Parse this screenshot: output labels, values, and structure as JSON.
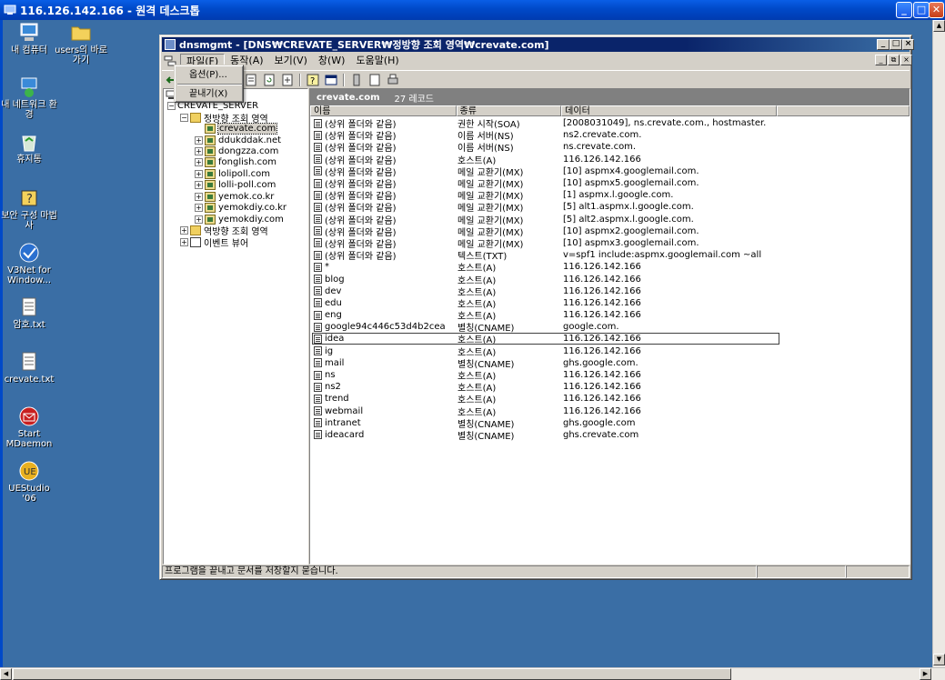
{
  "remote_desktop": {
    "title": "116.126.142.166 - 원격 데스크톱",
    "minimize": "_",
    "maximize": "□",
    "close": "✕"
  },
  "desktop_icons": [
    {
      "name": "my-computer",
      "label": "내 컴퓨터",
      "icon": "computer-icon"
    },
    {
      "name": "users-shortcut",
      "label": "users의 바로 가기",
      "icon": "folder-shortcut-icon"
    },
    {
      "name": "network-places",
      "label": "내 네트워크 환경",
      "icon": "network-icon"
    },
    {
      "name": "recycle-bin",
      "label": "휴지통",
      "icon": "recycle-bin-icon"
    },
    {
      "name": "security-wizard",
      "label": "보안 구성 마법사",
      "icon": "security-wizard-icon"
    },
    {
      "name": "v3net",
      "label": "V3Net for Window...",
      "icon": "v3net-icon"
    },
    {
      "name": "password-txt",
      "label": "암호.txt",
      "icon": "text-file-icon"
    },
    {
      "name": "crevate-txt",
      "label": "crevate.txt",
      "icon": "text-file-icon"
    },
    {
      "name": "start-mdaemon",
      "label": "Start MDaemon",
      "icon": "mdaemon-icon"
    },
    {
      "name": "uestudio",
      "label": "UEStudio '06",
      "icon": "uestudio-icon"
    }
  ],
  "mmc": {
    "title": "dnsmgmt - [DNS₩CREVATE_SERVER₩정방향 조회 영역₩crevate.com]",
    "menu": [
      {
        "label": "파일(F)",
        "active": true
      },
      {
        "label": "동작(A)",
        "active": false
      },
      {
        "label": "보기(V)",
        "active": false
      },
      {
        "label": "창(W)",
        "active": false
      },
      {
        "label": "도움말(H)",
        "active": false
      }
    ],
    "file_menu": {
      "items": [
        "옵션(P)...",
        "끝내기(X)"
      ]
    },
    "tree": {
      "server": "CREVATE_SERVER",
      "forward_zones": "정방향 조회 영역",
      "zones": [
        "crevate.com",
        "ddukddak.net",
        "dongzza.com",
        "fonglish.com",
        "lolipoll.com",
        "lolli-poll.com",
        "yemok.co.kr",
        "yemokdiy.co.kr",
        "yemokdiy.com"
      ],
      "selected_zone": "crevate.com",
      "reverse_zones": "역방향 조회 영역",
      "event_viewer": "이벤트 뷰어"
    },
    "list": {
      "zone_name": "crevate.com",
      "record_count": "27 레코드",
      "columns": [
        "이름",
        "종류",
        "데이터"
      ],
      "rows": [
        {
          "name": "(상위 폴더와 같음)",
          "type": "권한 시작(SOA)",
          "data": "[2008031049], ns.crevate.com., hostmaster."
        },
        {
          "name": "(상위 폴더와 같음)",
          "type": "이름 서버(NS)",
          "data": "ns2.crevate.com."
        },
        {
          "name": "(상위 폴더와 같음)",
          "type": "이름 서버(NS)",
          "data": "ns.crevate.com."
        },
        {
          "name": "(상위 폴더와 같음)",
          "type": "호스트(A)",
          "data": "116.126.142.166"
        },
        {
          "name": "(상위 폴더와 같음)",
          "type": "메일 교환기(MX)",
          "data": "[10]  aspmx4.googlemail.com."
        },
        {
          "name": "(상위 폴더와 같음)",
          "type": "메일 교환기(MX)",
          "data": "[10]  aspmx5.googlemail.com."
        },
        {
          "name": "(상위 폴더와 같음)",
          "type": "메일 교환기(MX)",
          "data": "[1]  aspmx.l.google.com."
        },
        {
          "name": "(상위 폴더와 같음)",
          "type": "메일 교환기(MX)",
          "data": "[5]  alt1.aspmx.l.google.com."
        },
        {
          "name": "(상위 폴더와 같음)",
          "type": "메일 교환기(MX)",
          "data": "[5]  alt2.aspmx.l.google.com."
        },
        {
          "name": "(상위 폴더와 같음)",
          "type": "메일 교환기(MX)",
          "data": "[10]  aspmx2.googlemail.com."
        },
        {
          "name": "(상위 폴더와 같음)",
          "type": "메일 교환기(MX)",
          "data": "[10]  aspmx3.googlemail.com."
        },
        {
          "name": "(상위 폴더와 같음)",
          "type": "텍스트(TXT)",
          "data": "v=spf1 include:aspmx.googlemail.com ~all"
        },
        {
          "name": "*",
          "type": "호스트(A)",
          "data": "116.126.142.166"
        },
        {
          "name": "blog",
          "type": "호스트(A)",
          "data": "116.126.142.166"
        },
        {
          "name": "dev",
          "type": "호스트(A)",
          "data": "116.126.142.166"
        },
        {
          "name": "edu",
          "type": "호스트(A)",
          "data": "116.126.142.166"
        },
        {
          "name": "eng",
          "type": "호스트(A)",
          "data": "116.126.142.166"
        },
        {
          "name": "google94c446c53d4b2cea",
          "type": "별칭(CNAME)",
          "data": "google.com."
        },
        {
          "name": "idea",
          "type": "호스트(A)",
          "data": "116.126.142.166",
          "focused": true
        },
        {
          "name": "ig",
          "type": "호스트(A)",
          "data": "116.126.142.166"
        },
        {
          "name": "mail",
          "type": "별칭(CNAME)",
          "data": "ghs.google.com."
        },
        {
          "name": "ns",
          "type": "호스트(A)",
          "data": "116.126.142.166"
        },
        {
          "name": "ns2",
          "type": "호스트(A)",
          "data": "116.126.142.166"
        },
        {
          "name": "trend",
          "type": "호스트(A)",
          "data": "116.126.142.166"
        },
        {
          "name": "webmail",
          "type": "호스트(A)",
          "data": "116.126.142.166"
        },
        {
          "name": "intranet",
          "type": "별칭(CNAME)",
          "data": "ghs.google.com"
        },
        {
          "name": "ideacard",
          "type": "별칭(CNAME)",
          "data": "ghs.crevate.com"
        }
      ]
    },
    "status_text": "프로그램을 끝내고 문서를 저장할지 묻습니다."
  },
  "colors": {
    "desktop": "#3a6ea5",
    "xp_title": "#0049c8",
    "classic_title": "#0a246a",
    "face": "#d4d0c8"
  }
}
